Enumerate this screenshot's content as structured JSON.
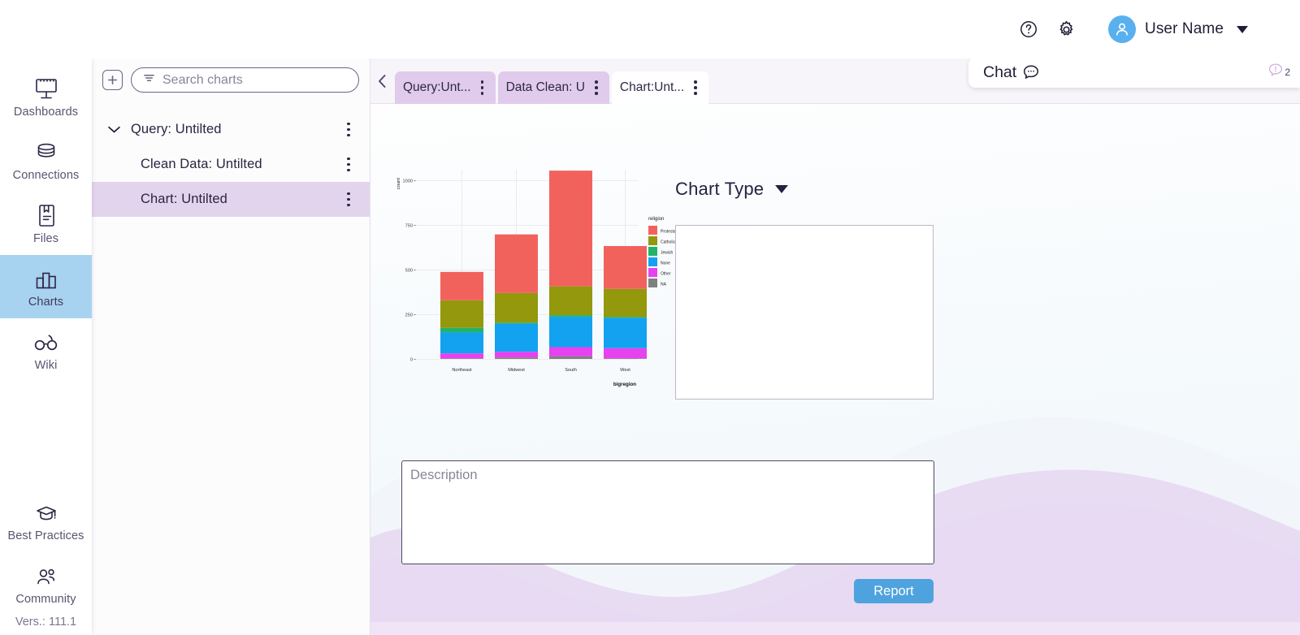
{
  "header": {
    "help_icon": "help-circle-icon",
    "settings_icon": "gear-icon",
    "user_name": "User Name",
    "user_icon": "user-avatar-icon",
    "dropdown_icon": "chevron-down-icon"
  },
  "chat": {
    "title": "Chat",
    "bubble_icon": "chat-bubble-icon",
    "badge_icon": "alert-bubble-icon",
    "badge_count": "2"
  },
  "rail": {
    "items": [
      {
        "label": "Dashboards",
        "icon": "dashboard-icon",
        "active": false
      },
      {
        "label": "Connections",
        "icon": "database-icon",
        "active": false
      },
      {
        "label": "Files",
        "icon": "file-bookmark-icon",
        "active": false
      },
      {
        "label": "Charts",
        "icon": "bar-chart-icon",
        "active": true
      },
      {
        "label": "Wiki",
        "icon": "glasses-icon",
        "active": false
      }
    ],
    "bottom_items": [
      {
        "label": "Best Practices",
        "icon": "graduation-cap-icon"
      },
      {
        "label": "Community",
        "icon": "people-icon"
      }
    ],
    "version": "Vers.: 111.1"
  },
  "explorer": {
    "add_button_icon": "plus-square-icon",
    "search": {
      "placeholder": "Search charts",
      "value": "",
      "icon": "filter-icon"
    },
    "tree": [
      {
        "label": "Query: Untilted",
        "level": 1,
        "selected": false,
        "chevron": "chevron-down-icon"
      },
      {
        "label": "Clean Data: Untilted",
        "level": 2,
        "selected": false
      },
      {
        "label": "Chart: Untilted",
        "level": 2,
        "selected": true
      }
    ]
  },
  "tabs": {
    "prev_icon": "chevron-left-icon",
    "next_icon": "chevron-right-icon",
    "items": [
      {
        "label": "Query:Unt...",
        "active": false
      },
      {
        "label": "Data Clean: U",
        "active": false
      },
      {
        "label": "Chart:Unt...",
        "active": true
      }
    ]
  },
  "editor": {
    "chart_type_label": "Chart Type",
    "chart_type_caret": "chevron-down-icon",
    "description_placeholder": "Description",
    "description_value": "",
    "report_label": "Report"
  },
  "colors": {
    "accent_purple": "#e0cbec",
    "accent_blue": "#4ea3de",
    "rail_active": "#a8d3f0",
    "tree_selected": "#e3d4ee",
    "wave": "#e3d2ee"
  },
  "chart_data": {
    "type": "bar",
    "stacked": true,
    "title": "",
    "xlabel": "bigregion",
    "ylabel": "count",
    "categories": [
      "Northeast",
      "Midwest",
      "South",
      "West"
    ],
    "legend_title": "religion",
    "legend_position": "right",
    "ylim": [
      0,
      1100
    ],
    "yticks": [
      0,
      250,
      500,
      750,
      1000
    ],
    "grid": true,
    "series": [
      {
        "name": "NA",
        "color": "#808080",
        "values": [
          3,
          8,
          14,
          3
        ]
      },
      {
        "name": "Other",
        "color": "#e642f0",
        "values": [
          28,
          32,
          52,
          57
        ]
      },
      {
        "name": "None",
        "color": "#12a2ef",
        "values": [
          117,
          158,
          170,
          171
        ]
      },
      {
        "name": "Jewish",
        "color": "#21b36b",
        "values": [
          26,
          5,
          9,
          3
        ]
      },
      {
        "name": "Catholic",
        "color": "#93980d",
        "values": [
          154,
          166,
          161,
          158
        ]
      },
      {
        "name": "Protestant",
        "color": "#f2625c",
        "values": [
          159,
          328,
          648,
          240
        ]
      }
    ],
    "totals": [
      487,
      697,
      1054,
      632
    ]
  }
}
